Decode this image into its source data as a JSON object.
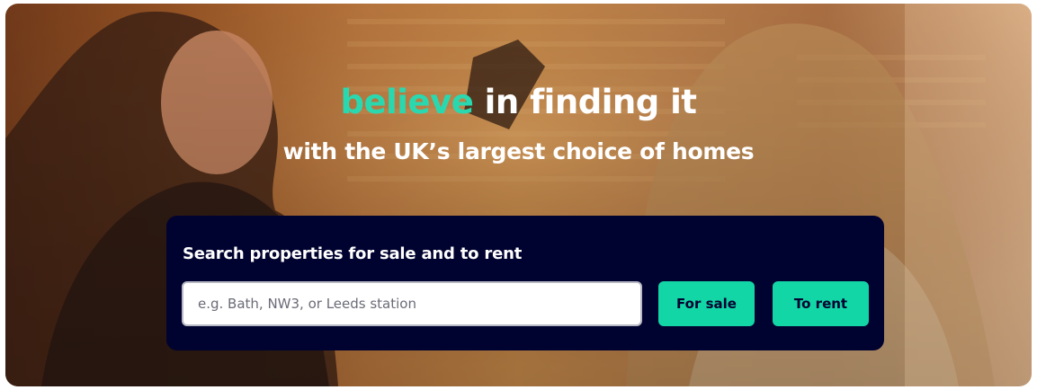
{
  "hero": {
    "headline_accent": "believe",
    "headline_rest": " in finding it",
    "subheadline": "with the UK’s largest choice of homes"
  },
  "search": {
    "title": "Search properties for sale and to rent",
    "placeholder": "e.g. Bath, NW3, or Leeds station",
    "value": "",
    "for_sale_label": "For sale",
    "to_rent_label": "To rent"
  },
  "colors": {
    "accent": "#2ad8b0",
    "button": "#13d6a7",
    "panel": "#00022f"
  }
}
